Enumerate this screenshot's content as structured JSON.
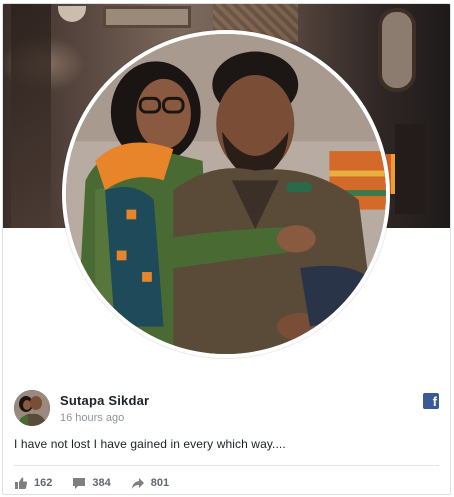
{
  "post": {
    "author": "Sutapa Sikdar",
    "timestamp": "16 hours ago",
    "text": "I have not lost I have gained in every which way....",
    "network_badge": "f"
  },
  "stats": {
    "likes": "162",
    "comments": "384",
    "shares": "801"
  },
  "icons": {
    "network": "facebook-icon",
    "likes": "thumbs-up-icon",
    "comments": "comment-icon",
    "shares": "share-arrow-icon"
  },
  "colors": {
    "brand": "#3b5998",
    "text": "#1d2129",
    "muted": "#90949c",
    "stat_text": "#616770"
  }
}
